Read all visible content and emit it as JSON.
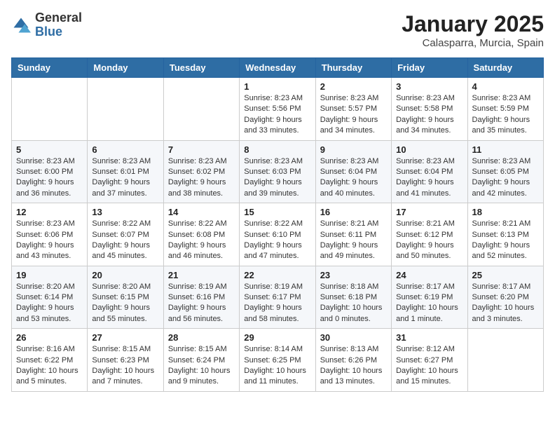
{
  "header": {
    "logo_general": "General",
    "logo_blue": "Blue",
    "month_title": "January 2025",
    "location": "Calasparra, Murcia, Spain"
  },
  "days_of_week": [
    "Sunday",
    "Monday",
    "Tuesday",
    "Wednesday",
    "Thursday",
    "Friday",
    "Saturday"
  ],
  "weeks": [
    [
      {
        "day": "",
        "info": ""
      },
      {
        "day": "",
        "info": ""
      },
      {
        "day": "",
        "info": ""
      },
      {
        "day": "1",
        "info": "Sunrise: 8:23 AM\nSunset: 5:56 PM\nDaylight: 9 hours\nand 33 minutes."
      },
      {
        "day": "2",
        "info": "Sunrise: 8:23 AM\nSunset: 5:57 PM\nDaylight: 9 hours\nand 34 minutes."
      },
      {
        "day": "3",
        "info": "Sunrise: 8:23 AM\nSunset: 5:58 PM\nDaylight: 9 hours\nand 34 minutes."
      },
      {
        "day": "4",
        "info": "Sunrise: 8:23 AM\nSunset: 5:59 PM\nDaylight: 9 hours\nand 35 minutes."
      }
    ],
    [
      {
        "day": "5",
        "info": "Sunrise: 8:23 AM\nSunset: 6:00 PM\nDaylight: 9 hours\nand 36 minutes."
      },
      {
        "day": "6",
        "info": "Sunrise: 8:23 AM\nSunset: 6:01 PM\nDaylight: 9 hours\nand 37 minutes."
      },
      {
        "day": "7",
        "info": "Sunrise: 8:23 AM\nSunset: 6:02 PM\nDaylight: 9 hours\nand 38 minutes."
      },
      {
        "day": "8",
        "info": "Sunrise: 8:23 AM\nSunset: 6:03 PM\nDaylight: 9 hours\nand 39 minutes."
      },
      {
        "day": "9",
        "info": "Sunrise: 8:23 AM\nSunset: 6:04 PM\nDaylight: 9 hours\nand 40 minutes."
      },
      {
        "day": "10",
        "info": "Sunrise: 8:23 AM\nSunset: 6:04 PM\nDaylight: 9 hours\nand 41 minutes."
      },
      {
        "day": "11",
        "info": "Sunrise: 8:23 AM\nSunset: 6:05 PM\nDaylight: 9 hours\nand 42 minutes."
      }
    ],
    [
      {
        "day": "12",
        "info": "Sunrise: 8:23 AM\nSunset: 6:06 PM\nDaylight: 9 hours\nand 43 minutes."
      },
      {
        "day": "13",
        "info": "Sunrise: 8:22 AM\nSunset: 6:07 PM\nDaylight: 9 hours\nand 45 minutes."
      },
      {
        "day": "14",
        "info": "Sunrise: 8:22 AM\nSunset: 6:08 PM\nDaylight: 9 hours\nand 46 minutes."
      },
      {
        "day": "15",
        "info": "Sunrise: 8:22 AM\nSunset: 6:10 PM\nDaylight: 9 hours\nand 47 minutes."
      },
      {
        "day": "16",
        "info": "Sunrise: 8:21 AM\nSunset: 6:11 PM\nDaylight: 9 hours\nand 49 minutes."
      },
      {
        "day": "17",
        "info": "Sunrise: 8:21 AM\nSunset: 6:12 PM\nDaylight: 9 hours\nand 50 minutes."
      },
      {
        "day": "18",
        "info": "Sunrise: 8:21 AM\nSunset: 6:13 PM\nDaylight: 9 hours\nand 52 minutes."
      }
    ],
    [
      {
        "day": "19",
        "info": "Sunrise: 8:20 AM\nSunset: 6:14 PM\nDaylight: 9 hours\nand 53 minutes."
      },
      {
        "day": "20",
        "info": "Sunrise: 8:20 AM\nSunset: 6:15 PM\nDaylight: 9 hours\nand 55 minutes."
      },
      {
        "day": "21",
        "info": "Sunrise: 8:19 AM\nSunset: 6:16 PM\nDaylight: 9 hours\nand 56 minutes."
      },
      {
        "day": "22",
        "info": "Sunrise: 8:19 AM\nSunset: 6:17 PM\nDaylight: 9 hours\nand 58 minutes."
      },
      {
        "day": "23",
        "info": "Sunrise: 8:18 AM\nSunset: 6:18 PM\nDaylight: 10 hours\nand 0 minutes."
      },
      {
        "day": "24",
        "info": "Sunrise: 8:17 AM\nSunset: 6:19 PM\nDaylight: 10 hours\nand 1 minute."
      },
      {
        "day": "25",
        "info": "Sunrise: 8:17 AM\nSunset: 6:20 PM\nDaylight: 10 hours\nand 3 minutes."
      }
    ],
    [
      {
        "day": "26",
        "info": "Sunrise: 8:16 AM\nSunset: 6:22 PM\nDaylight: 10 hours\nand 5 minutes."
      },
      {
        "day": "27",
        "info": "Sunrise: 8:15 AM\nSunset: 6:23 PM\nDaylight: 10 hours\nand 7 minutes."
      },
      {
        "day": "28",
        "info": "Sunrise: 8:15 AM\nSunset: 6:24 PM\nDaylight: 10 hours\nand 9 minutes."
      },
      {
        "day": "29",
        "info": "Sunrise: 8:14 AM\nSunset: 6:25 PM\nDaylight: 10 hours\nand 11 minutes."
      },
      {
        "day": "30",
        "info": "Sunrise: 8:13 AM\nSunset: 6:26 PM\nDaylight: 10 hours\nand 13 minutes."
      },
      {
        "day": "31",
        "info": "Sunrise: 8:12 AM\nSunset: 6:27 PM\nDaylight: 10 hours\nand 15 minutes."
      },
      {
        "day": "",
        "info": ""
      }
    ]
  ]
}
